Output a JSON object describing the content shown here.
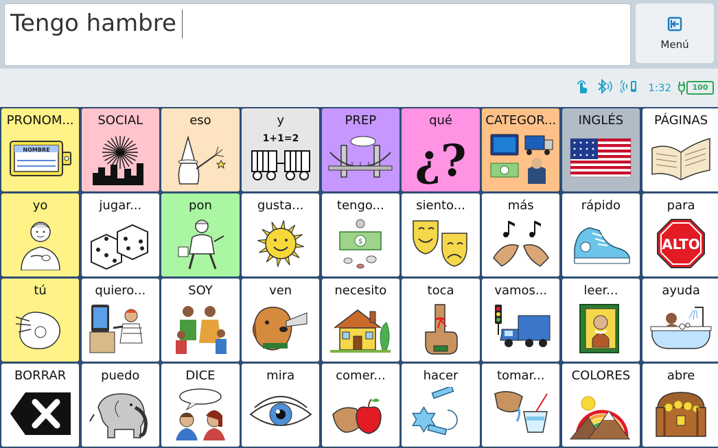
{
  "message": {
    "text": "Tengo hambre"
  },
  "menu": {
    "label": "Menú",
    "icon": "exit-icon"
  },
  "status": {
    "icons": [
      "touch-icon",
      "bluetooth-icon",
      "wireless-icon"
    ],
    "time": "1:32",
    "battery": "100"
  },
  "colors": {
    "yellow": "#fff287",
    "pink": "#ffc4cc",
    "peach": "#fde3bf",
    "gray": "#e6e6e6",
    "purple": "#c597ff",
    "magenta": "#ff93e4",
    "orange": "#ffc188",
    "bluegray": "#b1bcc6",
    "white": "#ffffff",
    "green": "#aaf6a2"
  },
  "grid": {
    "rows": [
      [
        {
          "label": "PRONOM...",
          "color": "yellow",
          "icon": "name-tag-icon"
        },
        {
          "label": "SOCIAL",
          "color": "pink",
          "icon": "fireworks-icon"
        },
        {
          "label": "eso",
          "color": "peach",
          "icon": "wizard-icon"
        },
        {
          "label": "y",
          "color": "gray",
          "icon": "train-cars-icon",
          "icon_text": "1+1=2"
        },
        {
          "label": "PREP",
          "color": "purple",
          "icon": "bridge-icon"
        },
        {
          "label": "qué",
          "color": "magenta",
          "icon": "question-marks-icon",
          "icon_text": "¿?"
        },
        {
          "label": "CATEGOR...",
          "color": "orange",
          "icon": "categories-icon"
        },
        {
          "label": "INGLÉS",
          "color": "bluegray",
          "icon": "us-flag-icon"
        },
        {
          "label": "PÁGINAS",
          "color": "white",
          "icon": "open-book-icon"
        }
      ],
      [
        {
          "label": "yo",
          "color": "yellow",
          "icon": "boy-self-icon"
        },
        {
          "label": "jugar...",
          "color": "white",
          "icon": "dice-icon"
        },
        {
          "label": "pon",
          "color": "green",
          "icon": "worker-icon"
        },
        {
          "label": "gusta...",
          "color": "white",
          "icon": "sun-icon"
        },
        {
          "label": "tengo...",
          "color": "white",
          "icon": "money-icon"
        },
        {
          "label": "siento...",
          "color": "white",
          "icon": "theater-masks-icon"
        },
        {
          "label": "más",
          "color": "white",
          "icon": "more-sign-icon"
        },
        {
          "label": "rápido",
          "color": "white",
          "icon": "sneaker-icon"
        },
        {
          "label": "para",
          "color": "white",
          "icon": "stop-sign-icon",
          "icon_text": "ALTO"
        }
      ],
      [
        {
          "label": "tú",
          "color": "yellow",
          "icon": "pointing-hand-icon"
        },
        {
          "label": "quiero...",
          "color": "white",
          "icon": "want-icon"
        },
        {
          "label": "SOY",
          "color": "white",
          "icon": "family-icon"
        },
        {
          "label": "ven",
          "color": "white",
          "icon": "dog-icon"
        },
        {
          "label": "necesito",
          "color": "white",
          "icon": "house-icon"
        },
        {
          "label": "toca",
          "color": "white",
          "icon": "finger-string-icon"
        },
        {
          "label": "vamos...",
          "color": "white",
          "icon": "truck-light-icon"
        },
        {
          "label": "leer...",
          "color": "white",
          "icon": "book-icon"
        },
        {
          "label": "ayuda",
          "color": "white",
          "icon": "bath-icon"
        }
      ],
      [
        {
          "label": "BORRAR",
          "color": "white",
          "icon": "delete-icon"
        },
        {
          "label": "puedo",
          "color": "white",
          "icon": "elephant-icon"
        },
        {
          "label": "DICE",
          "color": "white",
          "icon": "speech-bubble-icon"
        },
        {
          "label": "mira",
          "color": "white",
          "icon": "eye-icon"
        },
        {
          "label": "comer...",
          "color": "white",
          "icon": "hand-apple-icon"
        },
        {
          "label": "hacer",
          "color": "white",
          "icon": "shapes-icon"
        },
        {
          "label": "tomar...",
          "color": "white",
          "icon": "drink-icon"
        },
        {
          "label": "COLORES",
          "color": "white",
          "icon": "rainbow-icon"
        },
        {
          "label": "abre",
          "color": "white",
          "icon": "treasure-chest-icon"
        }
      ]
    ]
  }
}
